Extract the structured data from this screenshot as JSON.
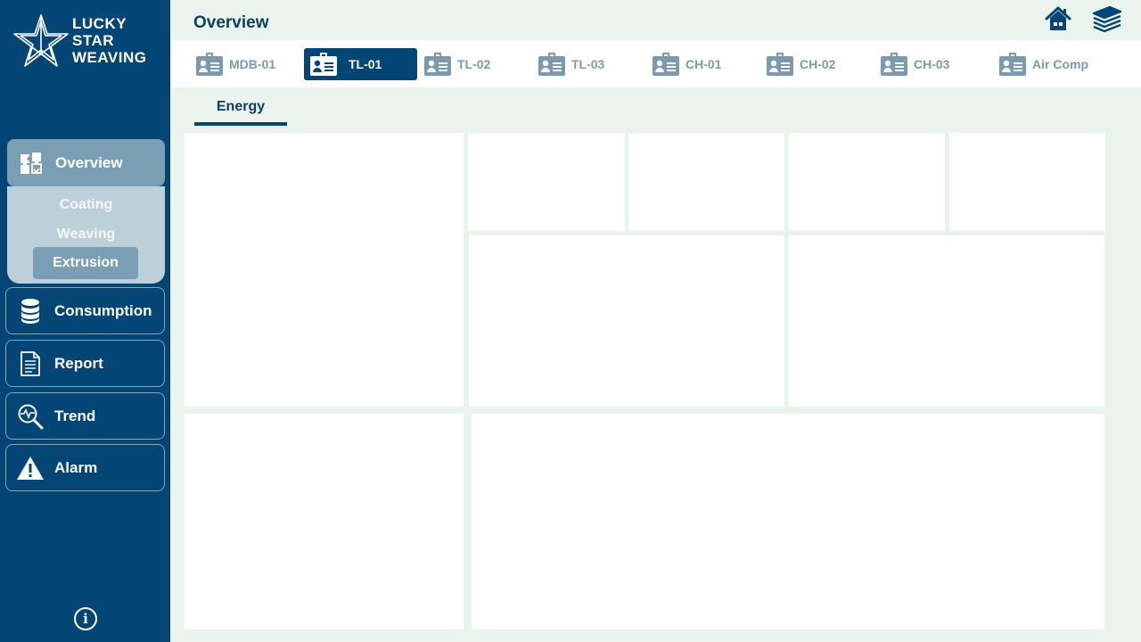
{
  "brand": {
    "line1": "LUCKY",
    "line2": "STAR",
    "line3": "WEAVING"
  },
  "header": {
    "title": "Overview"
  },
  "nav": {
    "overview": "Overview",
    "sub": [
      "Coating",
      "Weaving",
      "Extrusion"
    ],
    "consumption": "Consumption",
    "report": "Report",
    "trend": "Trend",
    "alarm": "Alarm"
  },
  "info_label": "i",
  "tabs": [
    "MDB-01",
    "TL-01",
    "TL-02",
    "TL-03",
    "CH-01",
    "CH-02",
    "CH-03",
    "Air Comp"
  ],
  "active_tab": "TL-01",
  "subtab": "Energy",
  "colors": {
    "sidebar": "#034575",
    "accent_muted": "#7a9fb4",
    "background": "#eaf3ec",
    "tab_inactive": "#7b9aae"
  }
}
